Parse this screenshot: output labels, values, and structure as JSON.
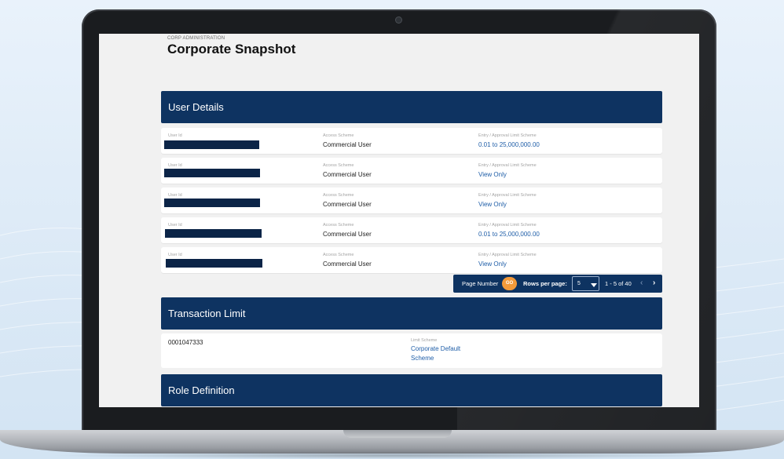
{
  "app": {
    "eyebrow": "CORP ADMINISTRATION",
    "title": "Corporate Snapshot"
  },
  "sections": {
    "user_details": "User Details",
    "transaction_limit": "Transaction Limit",
    "role_definition": "Role Definition"
  },
  "users": {
    "labels": {
      "user_id": "User Id",
      "access_scheme": "Access Scheme",
      "limit_scheme": "Entry / Approval Limit Scheme"
    },
    "rows": [
      {
        "access": "Commercial User",
        "limit": "0.01 to 25,000,000.00"
      },
      {
        "access": "Commercial User",
        "limit": "View Only"
      },
      {
        "access": "Commercial User",
        "limit": "View Only"
      },
      {
        "access": "Commercial User",
        "limit": "0.01 to 25,000,000.00"
      },
      {
        "access": "Commercial User",
        "limit": "View Only"
      }
    ]
  },
  "pager": {
    "page_number_label": "Page Number",
    "go_label": "GO",
    "rows_per_page_label": "Rows per page:",
    "rows_per_page_value": "5",
    "range": "1 - 5 of 40",
    "prev": "‹",
    "next": "›"
  },
  "transaction_limit": {
    "account": "0001047333",
    "limit_label": "Limit Scheme",
    "limit_value_line1": "Corporate Default",
    "limit_value_line2": "Scheme"
  },
  "colors": {
    "brand_navy": "#0e3361",
    "link_blue": "#1f5ea8",
    "go_orange": "#f39a3a",
    "redaction": "#0b2447"
  }
}
